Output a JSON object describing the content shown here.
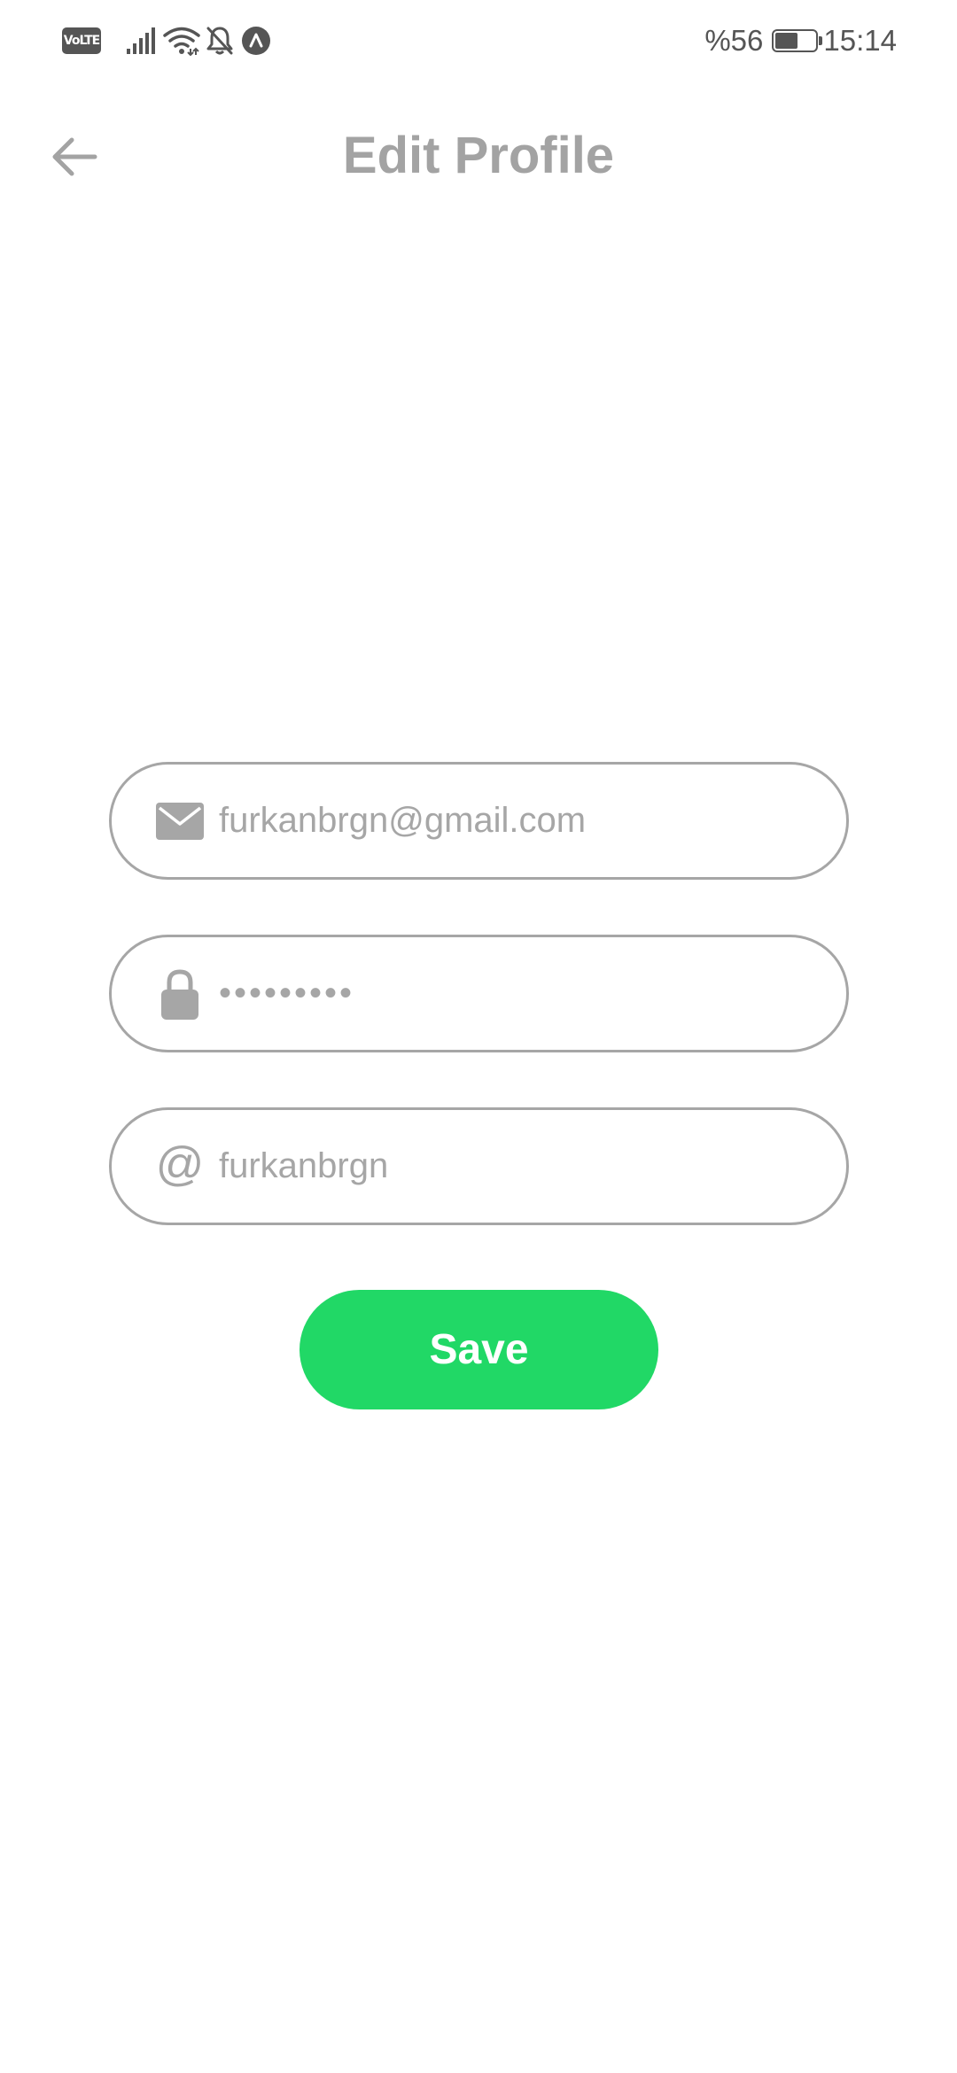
{
  "status_bar": {
    "network_badge": "VoLTE",
    "battery_text": "%56",
    "battery_level_percent": 56,
    "time": "15:14",
    "icons": [
      "volte-icon",
      "signal-icon",
      "wifi-icon",
      "bell-off-icon",
      "app-notification-icon",
      "battery-icon"
    ]
  },
  "header": {
    "title": "Edit Profile",
    "back_icon": "arrow-left-icon"
  },
  "form": {
    "email": {
      "icon": "envelope-icon",
      "value": "furkanbrgn@gmail.com"
    },
    "password": {
      "icon": "lock-icon",
      "value": "•••••••••"
    },
    "username": {
      "icon": "at-icon",
      "symbol": "@",
      "value": "furkanbrgn"
    },
    "save_label": "Save"
  },
  "colors": {
    "accent": "#21d866",
    "text_muted": "#a3a3a3",
    "border": "#a6a6a6",
    "status_icons": "#555555",
    "background": "#ffffff"
  }
}
